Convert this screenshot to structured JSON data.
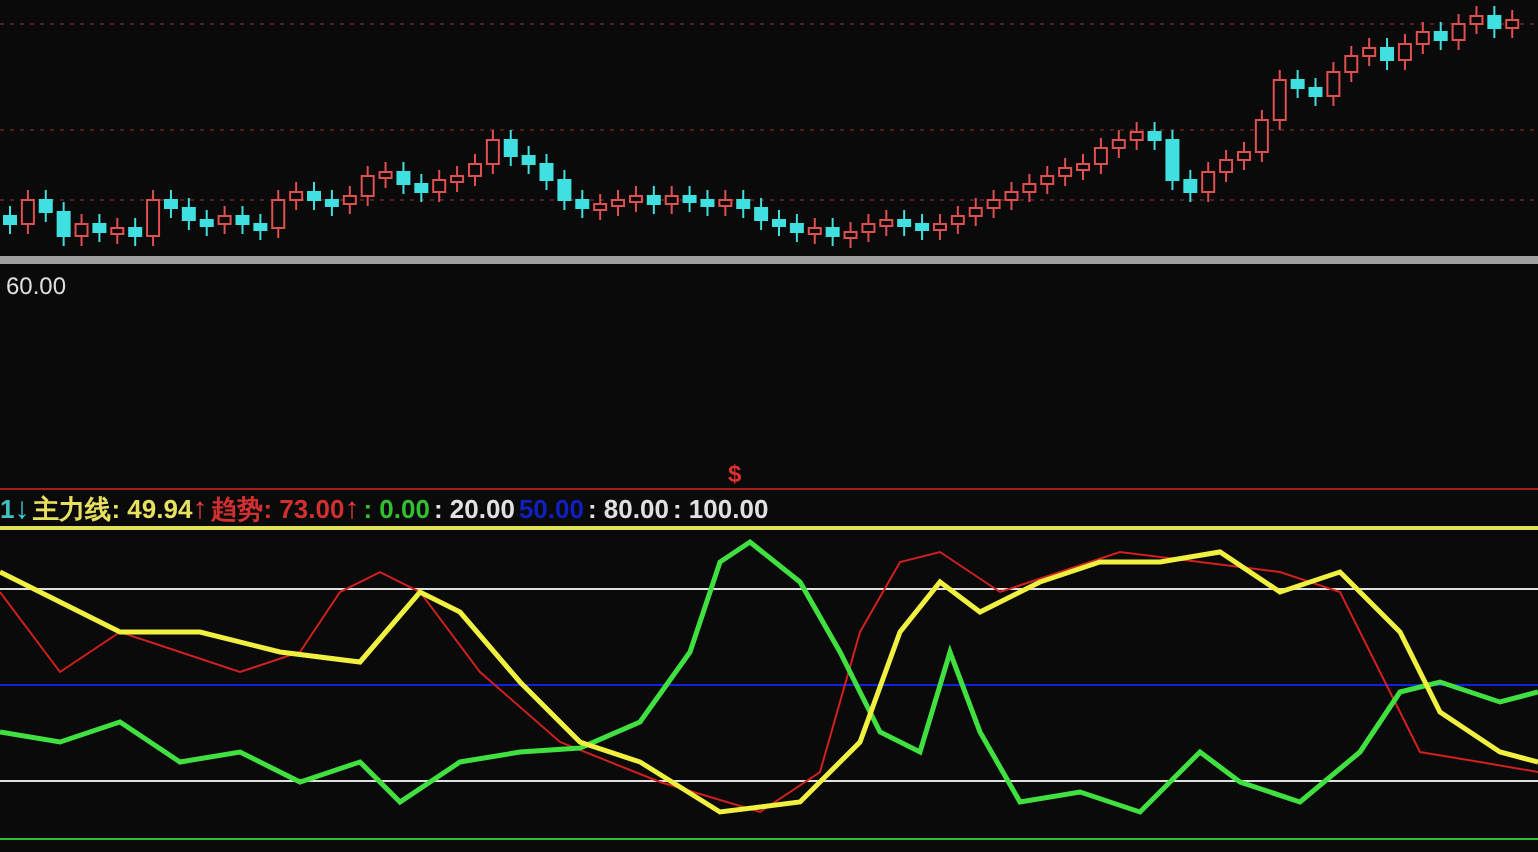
{
  "mid_panel": {
    "axis_value": "60.00"
  },
  "signal_mark": "$",
  "legend": [
    {
      "kind": "text",
      "text": "1",
      "color": "#40c0c0"
    },
    {
      "kind": "arrow",
      "text": "↓",
      "color": "#40d0e0"
    },
    {
      "kind": "text",
      "text": "主力线: 49.94",
      "color": "#e8e060"
    },
    {
      "kind": "arrow",
      "text": "↑",
      "color": "#e04040"
    },
    {
      "kind": "text",
      "text": "趋势: 73.00",
      "color": "#d03030"
    },
    {
      "kind": "arrow",
      "text": "↑",
      "color": "#e04040"
    },
    {
      "kind": "text",
      "text": ": 0.00",
      "color": "#30c030"
    },
    {
      "kind": "text",
      "text": ": 20.00",
      "color": "#e0e0e0"
    },
    {
      "kind": "text",
      "text": "50.00",
      "color": "#1020c0"
    },
    {
      "kind": "text",
      "text": ": 80.00",
      "color": "#e0e0e0"
    },
    {
      "kind": "text",
      "text": ": 100.00",
      "color": "#e0e0e0"
    }
  ]
}
